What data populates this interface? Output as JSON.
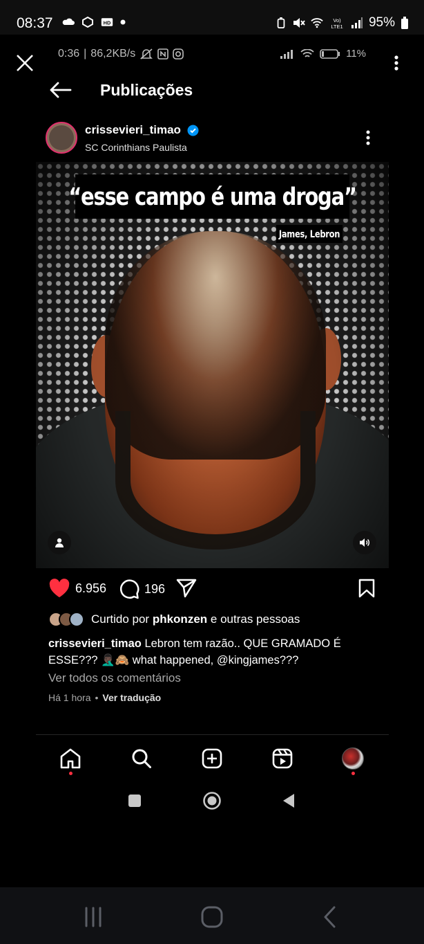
{
  "status_bar": {
    "time": "08:37",
    "battery": "95%",
    "left_icons": [
      "cloud-icon",
      "app-icon",
      "hd-icon",
      "dot-icon"
    ],
    "right_icons": [
      "battery-saver-icon",
      "mute-icon",
      "wifi-icon",
      "volte-icon",
      "signal-icon",
      "battery-icon"
    ]
  },
  "recording_overlay": {
    "elapsed": "0:36",
    "speed": "86,2KB/s",
    "battery": "11%",
    "icons": [
      "close-icon",
      "bell-off-icon",
      "nfc-icon",
      "instagram-icon",
      "signal-icon",
      "wifi-icon",
      "battery-icon",
      "more-icon"
    ]
  },
  "header": {
    "title": "Publicações"
  },
  "post": {
    "username": "crissevieri_timao",
    "verified": true,
    "location": "SC Corinthians Paulista",
    "media": {
      "quote": "“esse campo é uma droga”",
      "credit": "James, Lebron"
    },
    "likes": "6.956",
    "comments": "196",
    "liked_by_prefix": "Curtido por ",
    "liked_by_user": "phkonzen",
    "liked_by_suffix": " e outras pessoas",
    "caption_text": "Lebron tem razão.. QUE GRAMADO É ESSE??? 🤦🏿‍♂️🙈 what happened, @kingjames???",
    "view_comments": "Ver todos os comentários",
    "time": "Há 1 hora",
    "separator": "•",
    "translate": "Ver tradução"
  },
  "bottom_nav": {
    "items": [
      "home-icon",
      "search-icon",
      "create-icon",
      "reels-icon",
      "profile-avatar"
    ]
  },
  "colors": {
    "like": "#ff3040",
    "verified": "#0095f6",
    "notification_dot": "#ff3040",
    "background": "#000000"
  }
}
